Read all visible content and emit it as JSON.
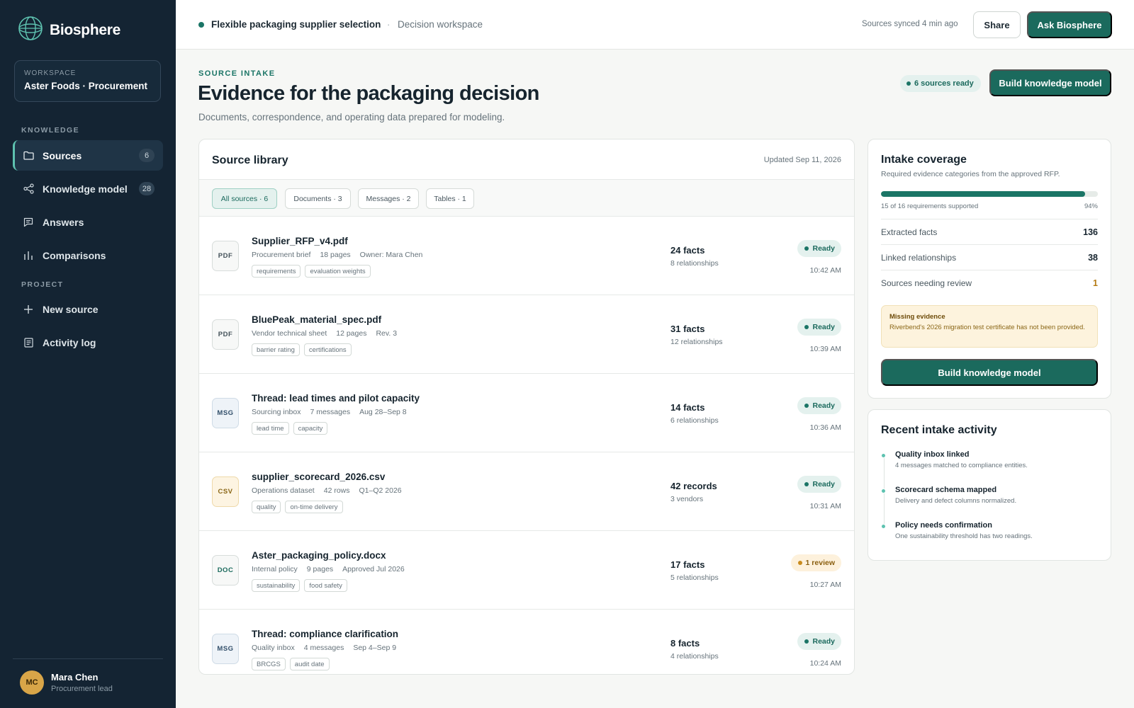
{
  "app": {
    "brand": "Biosphere",
    "workspace_label": "WORKSPACE",
    "workspace_name": "Aster Foods · Procurement"
  },
  "sidebar": {
    "knowledge_heading": "KNOWLEDGE",
    "project_heading": "PROJECT",
    "knowledge_items": [
      {
        "label": "Sources",
        "badge": "6",
        "icon": "folder-icon",
        "active": true
      },
      {
        "label": "Knowledge model",
        "badge": "28",
        "icon": "share-nodes-icon"
      },
      {
        "label": "Answers",
        "icon": "message-icon"
      },
      {
        "label": "Comparisons",
        "icon": "bar-chart-icon"
      }
    ],
    "project_items": [
      {
        "label": "New source",
        "icon": "plus-icon"
      },
      {
        "label": "Activity log",
        "icon": "log-icon"
      }
    ],
    "user": {
      "initials": "MC",
      "name": "Mara Chen",
      "role": "Procurement lead"
    }
  },
  "topbar": {
    "title": "Flexible packaging supplier selection",
    "separator": "·",
    "subtitle": "Decision workspace",
    "sync_status": "Sources synced 4 min ago",
    "share_label": "Share",
    "ask_label": "Ask Biosphere"
  },
  "header": {
    "eyebrow": "SOURCE INTAKE",
    "title": "Evidence for the packaging decision",
    "description": "Documents, correspondence, and operating data prepared for modeling.",
    "ready_chip": "6 sources ready",
    "build_label": "Build knowledge model"
  },
  "library": {
    "title": "Source library",
    "updated": "Updated Sep 11, 2026",
    "filters": [
      {
        "label": "All sources · 6",
        "active": true
      },
      {
        "label": "Documents · 3"
      },
      {
        "label": "Messages · 2"
      },
      {
        "label": "Tables · 1"
      }
    ],
    "sources": [
      {
        "type": "PDF",
        "name": "Supplier_RFP_v4.pdf",
        "meta": [
          "Procurement brief",
          "18 pages",
          "Owner: Mara Chen"
        ],
        "tags": [
          "requirements",
          "evaluation weights"
        ],
        "count": "24 facts",
        "relations": "8 relationships",
        "status": "Ready",
        "status_kind": "ready",
        "time": "10:42 AM"
      },
      {
        "type": "PDF",
        "name": "BluePeak_material_spec.pdf",
        "meta": [
          "Vendor technical sheet",
          "12 pages",
          "Rev. 3"
        ],
        "tags": [
          "barrier rating",
          "certifications"
        ],
        "count": "31 facts",
        "relations": "12 relationships",
        "status": "Ready",
        "status_kind": "ready",
        "time": "10:39 AM"
      },
      {
        "type": "MSG",
        "name": "Thread: lead times and pilot capacity",
        "meta": [
          "Sourcing inbox",
          "7 messages",
          "Aug 28–Sep 8"
        ],
        "tags": [
          "lead time",
          "capacity"
        ],
        "count": "14 facts",
        "relations": "6 relationships",
        "status": "Ready",
        "status_kind": "ready",
        "time": "10:36 AM"
      },
      {
        "type": "CSV",
        "name": "supplier_scorecard_2026.csv",
        "meta": [
          "Operations dataset",
          "42 rows",
          "Q1–Q2 2026"
        ],
        "tags": [
          "quality",
          "on-time delivery"
        ],
        "count": "42 records",
        "relations": "3 vendors",
        "status": "Ready",
        "status_kind": "ready",
        "time": "10:31 AM"
      },
      {
        "type": "DOC",
        "name": "Aster_packaging_policy.docx",
        "meta": [
          "Internal policy",
          "9 pages",
          "Approved Jul 2026"
        ],
        "tags": [
          "sustainability",
          "food safety"
        ],
        "count": "17 facts",
        "relations": "5 relationships",
        "status": "1 review",
        "status_kind": "review",
        "time": "10:27 AM"
      },
      {
        "type": "MSG",
        "name": "Thread: compliance clarification",
        "meta": [
          "Quality inbox",
          "4 messages",
          "Sep 4–Sep 9"
        ],
        "tags": [
          "BRCGS",
          "audit date"
        ],
        "count": "8 facts",
        "relations": "4 relationships",
        "status": "Ready",
        "status_kind": "ready",
        "time": "10:24 AM"
      }
    ]
  },
  "coverage": {
    "title": "Intake coverage",
    "subtitle": "Required evidence categories from the approved RFP.",
    "progress_fraction": 0.94,
    "progress_caption": "15 of 16 requirements supported",
    "progress_pct": "94%",
    "stats": [
      {
        "label": "Extracted facts",
        "value": "136"
      },
      {
        "label": "Linked relationships",
        "value": "38"
      },
      {
        "label": "Sources needing review",
        "value": "1",
        "warn": true
      }
    ],
    "missing_title": "Missing evidence",
    "missing_text": "Riverbend's 2026 migration test certificate has not been provided.",
    "build_label": "Build knowledge model"
  },
  "activity": {
    "title": "Recent intake activity",
    "items": [
      {
        "name": "Quality inbox linked",
        "desc": "4 messages matched to compliance entities."
      },
      {
        "name": "Scorecard schema mapped",
        "desc": "Delivery and defect columns normalized."
      },
      {
        "name": "Policy needs confirmation",
        "desc": "One sustainability threshold has two readings."
      }
    ]
  },
  "colors": {
    "sidebar_bg": "#142433",
    "accent": "#1b6a5d",
    "accent_light": "#5ec2b0",
    "warning": "#c98b1c"
  }
}
